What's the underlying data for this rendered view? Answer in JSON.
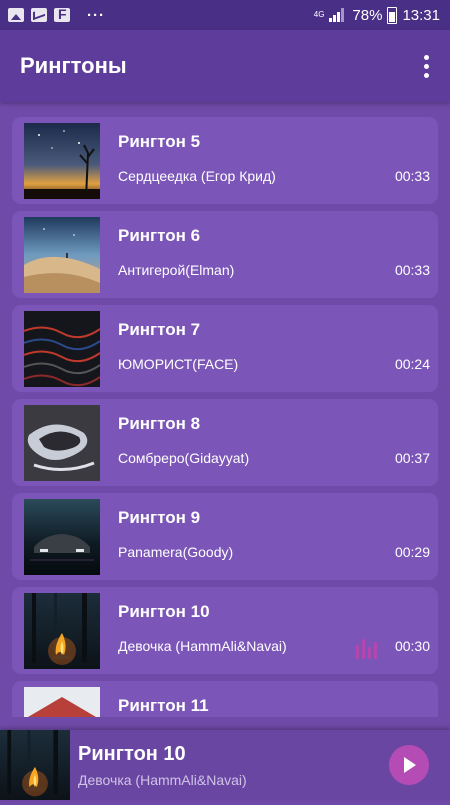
{
  "status_bar": {
    "network": "4G",
    "battery": "78%",
    "time": "13:31",
    "overflow": "···"
  },
  "app_bar": {
    "title": "Рингтоны"
  },
  "ringtones": [
    {
      "title": "Рингтон 5",
      "artist": "Сердцеедка (Егор Крид)",
      "duration": "00:33",
      "art": "starry-night-tree"
    },
    {
      "title": "Рингтон 6",
      "artist": "Антигерой(Elman)",
      "duration": "00:33",
      "art": "desert-dunes-night"
    },
    {
      "title": "Рингтон 7",
      "artist": "ЮМОРИСТ(FACE)",
      "duration": "00:24",
      "art": "dark-lava-waves"
    },
    {
      "title": "Рингтон 8",
      "artist": "Сомбреро(Gidayyat)",
      "duration": "00:37",
      "art": "abstract-marble"
    },
    {
      "title": "Рингтон 9",
      "artist": "Panamera(Goody)",
      "duration": "00:29",
      "art": "car-night"
    },
    {
      "title": "Рингтон 10",
      "artist": "Девочка (HammAli&Navai)",
      "duration": "00:30",
      "art": "campfire-forest",
      "playing": true
    },
    {
      "title": "Рингтон 11",
      "artist": "",
      "duration": "",
      "art": "red-building"
    }
  ],
  "now_playing": {
    "title": "Рингтон 10",
    "artist": "Девочка (HammAli&Navai)",
    "art": "campfire-forest"
  },
  "colors": {
    "background": "#6f4aa8",
    "app_bar": "#5e3c9b",
    "card": "#7b56b8",
    "accent": "#b54cb5"
  }
}
